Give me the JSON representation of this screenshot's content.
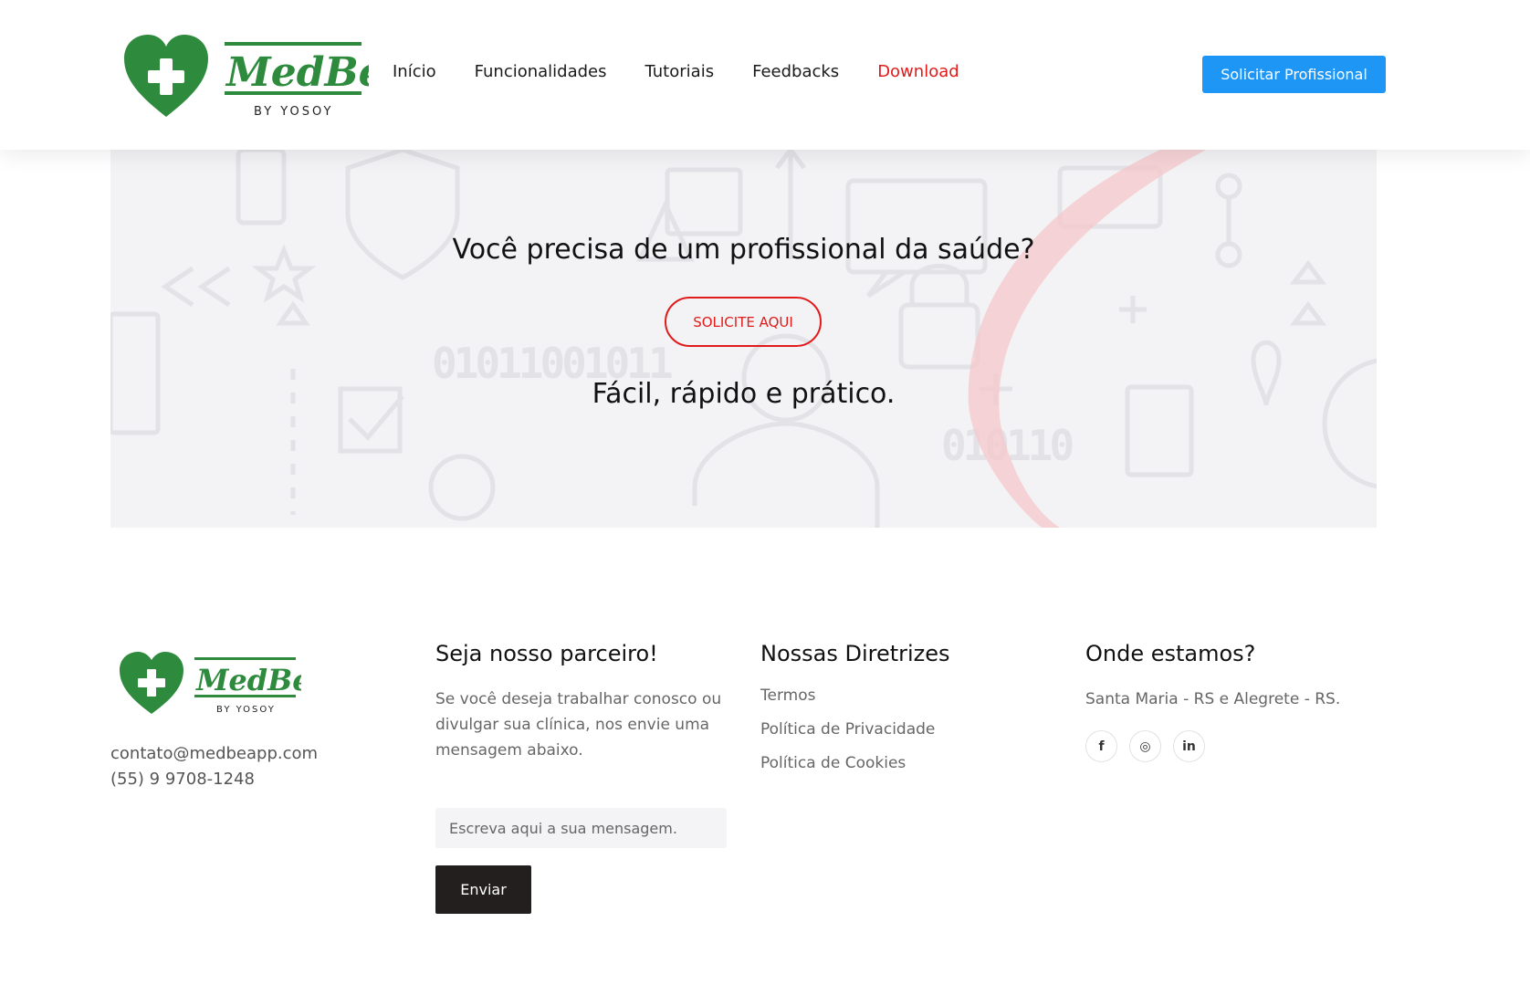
{
  "brand": {
    "name": "MedBe",
    "byline": "BY YOSOY",
    "green": "#2e8b3d",
    "red": "#e11a1a",
    "blue": "#1e96f5"
  },
  "nav": {
    "items": [
      {
        "label": "Início"
      },
      {
        "label": "Funcionalidades"
      },
      {
        "label": "Tutoriais"
      },
      {
        "label": "Feedbacks"
      },
      {
        "label": "Download"
      }
    ],
    "cta": "Solicitar Profissional"
  },
  "hero": {
    "title": "Você precisa de um profissional da saúde?",
    "button": "SOLICITE AQUI",
    "subtitle": "Fácil, rápido e prático."
  },
  "footer": {
    "contact": {
      "email": "contato@medbeapp.com",
      "phone": "(55) 9 9708-1248"
    },
    "partner": {
      "heading": "Seja nosso parceiro!",
      "text": "Se você deseja trabalhar conosco ou divulgar sua clínica, nos envie uma mensagem abaixo.",
      "placeholder": "Escreva aqui a sua mensagem.",
      "send": "Enviar"
    },
    "guidelines": {
      "heading": "Nossas Diretrizes",
      "links": [
        "Termos",
        "Política de Privacidade",
        "Política de Cookies"
      ]
    },
    "location": {
      "heading": "Onde estamos?",
      "text": "Santa Maria - RS e Alegrete - RS.",
      "socials": [
        {
          "icon": "facebook-icon",
          "glyph": "f"
        },
        {
          "icon": "instagram-icon",
          "glyph": "◎"
        },
        {
          "icon": "linkedin-icon",
          "glyph": "in"
        }
      ]
    }
  }
}
